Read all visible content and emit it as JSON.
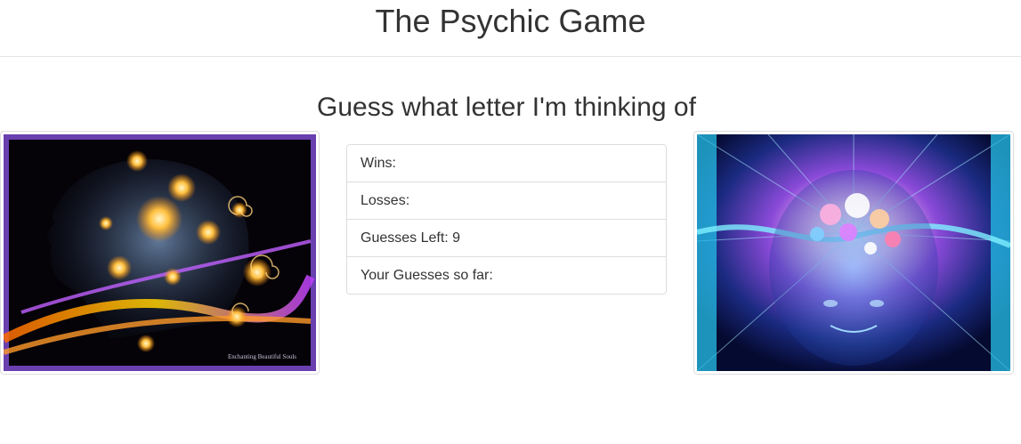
{
  "header": {
    "title": "The Psychic Game"
  },
  "main": {
    "subtitle": "Guess what letter I'm thinking of",
    "stats": {
      "wins_label": "Wins:",
      "losses_label": "Losses:",
      "guesses_left_label": "Guesses Left: 9",
      "guesses_so_far_label": "Your Guesses so far:"
    },
    "left_image": {
      "icon": "psychic-woman-profile-image",
      "watermark": "Enchanting Beautiful Souls"
    },
    "right_image": {
      "icon": "glowing-brain-head-image"
    }
  }
}
